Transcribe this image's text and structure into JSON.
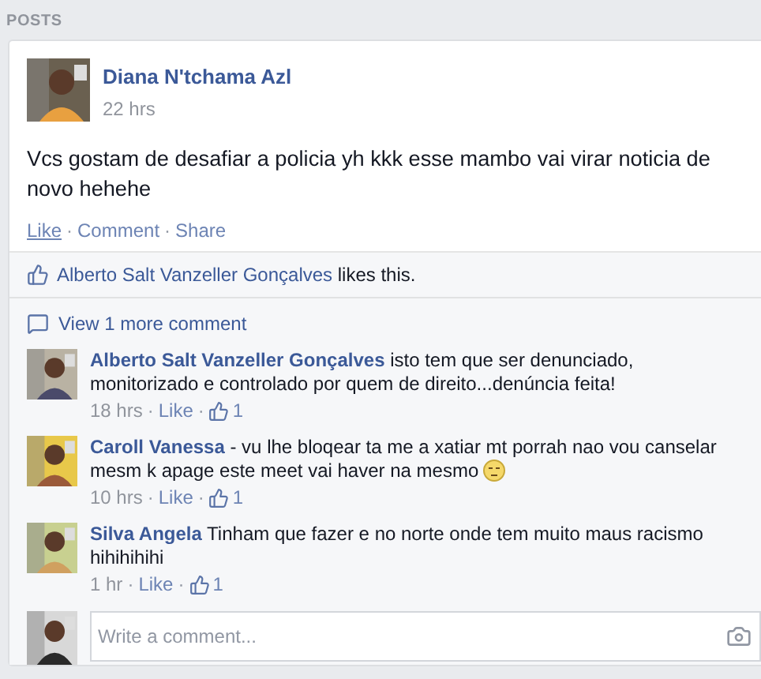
{
  "section_title": "POSTS",
  "post": {
    "author": "Diana N'tchama Azl",
    "time": "22 hrs",
    "text": "Vcs gostam de desafiar a policia yh kkk esse mambo vai virar noticia de novo hehehe",
    "separators": [
      "·",
      "·"
    ],
    "actions": [
      {
        "label": "Like",
        "hovered": true
      },
      {
        "label": "Comment",
        "hovered": false
      },
      {
        "label": "Share",
        "hovered": false
      }
    ]
  },
  "likes": {
    "name": "Alberto Salt Vanzeller Gonçalves",
    "suffix": " likes this."
  },
  "view_more": "View 1 more comment",
  "comments": [
    {
      "author": "Alberto Salt Vanzeller Gonçalves",
      "text": " isto tem que ser denunciado, monitorizado e controlado por quem de direito...denúncia feita!",
      "emoji": false,
      "separators": [
        "·",
        "·"
      ],
      "time": "18 hrs",
      "like": "Like",
      "like_count": "1"
    },
    {
      "author": "Caroll Vanessa",
      "text": " - vu lhe bloqear ta me a xatiar mt porrah nao vou canselar mesm k apage este meet vai haver na mesmo ",
      "emoji": true,
      "separators": [
        "·",
        "·"
      ],
      "time": "10 hrs",
      "like": "Like",
      "like_count": "1"
    },
    {
      "author": "Silva Angela",
      "text": " Tinham que fazer e no norte onde tem muito maus racismo hihihihihi",
      "emoji": false,
      "separators": [
        "·",
        "·"
      ],
      "time": "1 hr",
      "like": "Like",
      "like_count": "1"
    }
  ],
  "composer": {
    "placeholder": "Write a comment..."
  }
}
